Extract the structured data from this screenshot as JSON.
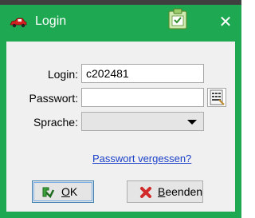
{
  "window": {
    "title": "Login",
    "close_glyph": "✕",
    "accent_color": "#1ea852"
  },
  "form": {
    "login_label": "Login:",
    "login_value": "c202481",
    "password_label": "Passwort:",
    "password_value": "",
    "language_label": "Sprache:",
    "language_value": ""
  },
  "link": {
    "forgot_password": "Passwort vergessen?"
  },
  "buttons": {
    "ok_mnemonic": "O",
    "ok_rest": "K",
    "end_mnemonic": "B",
    "end_rest": "eenden"
  },
  "icons": {
    "app": "car-icon",
    "title_button": "clipboard-icon",
    "keyboard": "keyboard-icon",
    "ok": "check-arrow-icon",
    "end": "red-x-icon"
  }
}
